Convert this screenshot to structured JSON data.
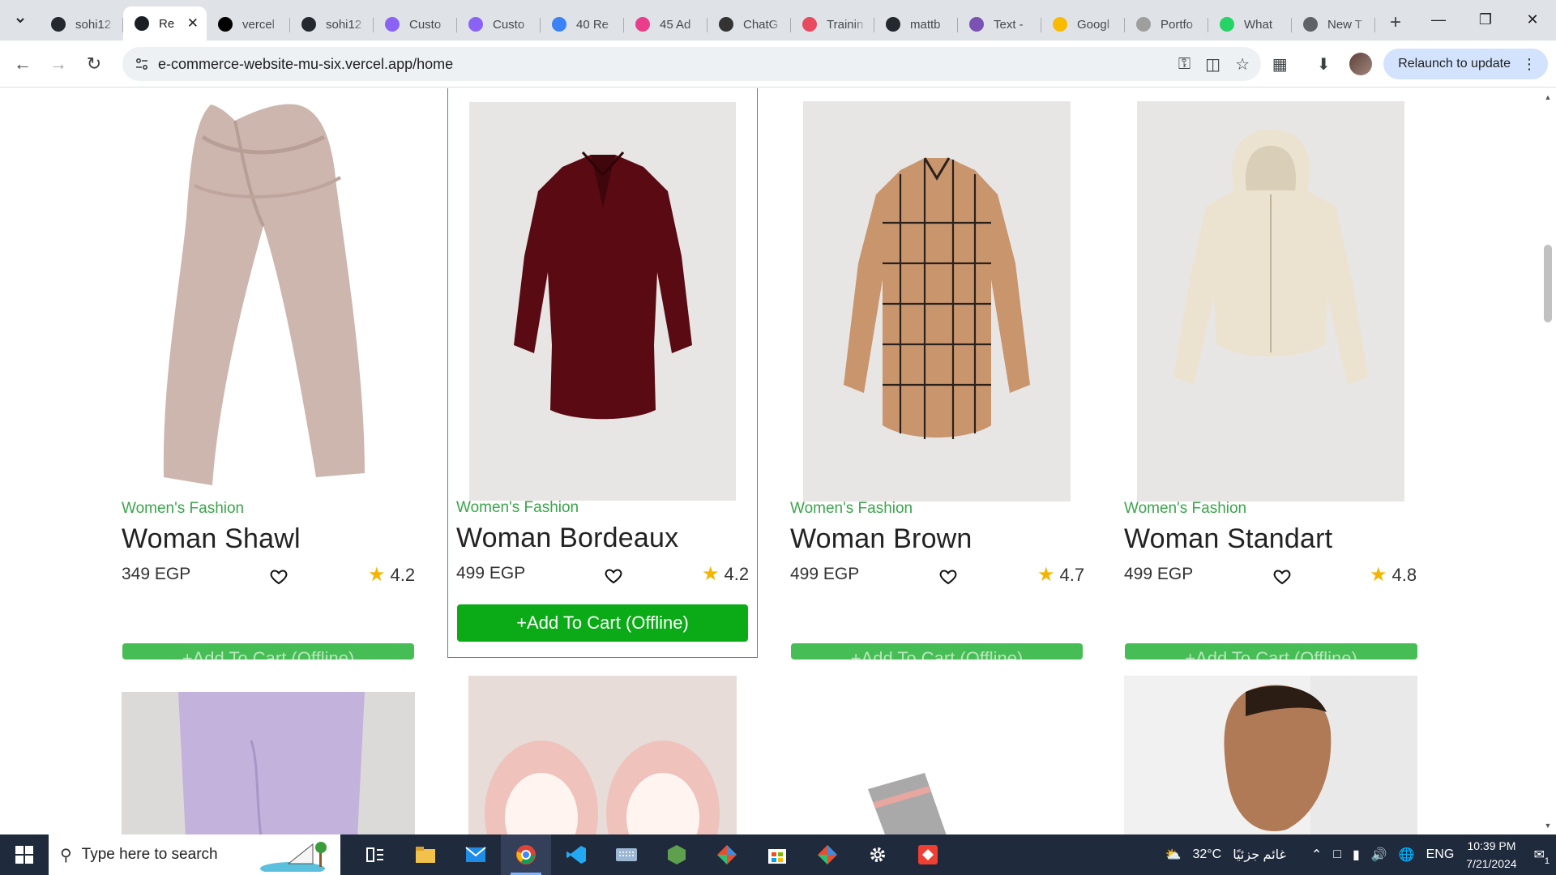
{
  "browser": {
    "tabs": [
      {
        "label": "sohi12",
        "favicon": "github-icon",
        "color": "#24292f",
        "active": false
      },
      {
        "label": "Re",
        "favicon": "react-icon",
        "color": "#1b1f24",
        "active": true
      },
      {
        "label": "vercel",
        "favicon": "vercel-icon",
        "color": "#000000",
        "active": false
      },
      {
        "label": "sohi12",
        "favicon": "github-icon",
        "color": "#24292f",
        "active": false
      },
      {
        "label": "Custo",
        "favicon": "vite-icon",
        "color": "#8a63f5",
        "active": false
      },
      {
        "label": "Custo",
        "favicon": "vite-icon",
        "color": "#8a63f5",
        "active": false
      },
      {
        "label": "40 Re",
        "favicon": "chart-icon",
        "color": "#3b82f6",
        "active": false
      },
      {
        "label": "45 Ad",
        "favicon": "bookmark-icon",
        "color": "#e83e8c",
        "active": false
      },
      {
        "label": "ChatG",
        "favicon": "openai-icon",
        "color": "#333333",
        "active": false
      },
      {
        "label": "Trainin",
        "favicon": "training-icon",
        "color": "#e84a5f",
        "active": false
      },
      {
        "label": "mattb",
        "favicon": "github-icon",
        "color": "#24292f",
        "active": false
      },
      {
        "label": "Text -",
        "favicon": "bootstrap-icon",
        "color": "#7952b3",
        "active": false
      },
      {
        "label": "Googl",
        "favicon": "google-keep-icon",
        "color": "#f9bb00",
        "active": false
      },
      {
        "label": "Portfo",
        "favicon": "portfolio-icon",
        "color": "#9e9e9e",
        "active": false
      },
      {
        "label": "What",
        "favicon": "whatsapp-icon",
        "color": "#25d366",
        "active": false
      },
      {
        "label": "New T",
        "favicon": "chrome-icon",
        "color": "#5f6368",
        "active": false
      }
    ],
    "url": "e-commerce-website-mu-six.vercel.app/home",
    "relaunch_label": "Relaunch to update"
  },
  "products_row1": [
    {
      "category": "Women's Fashion",
      "name": "Woman Shawl",
      "price": "349 EGP",
      "rating": "4.2",
      "button": "+Add To Cart (Offline)",
      "image": "shawl-image"
    },
    {
      "category": "Women's Fashion",
      "name": "Woman Bordeaux",
      "price": "499 EGP",
      "rating": "4.2",
      "button": "+Add To Cart (Offline)",
      "image": "bordeaux-shirt-image"
    },
    {
      "category": "Women's Fashion",
      "name": "Woman Brown",
      "price": "499 EGP",
      "rating": "4.7",
      "button": "+Add To Cart (Offline)",
      "image": "brown-plaid-shirt-image"
    },
    {
      "category": "Women's Fashion",
      "name": "Woman Standart",
      "price": "499 EGP",
      "rating": "4.8",
      "button": "+Add To Cart (Offline)",
      "image": "cream-hoodie-image"
    }
  ],
  "colors": {
    "accent_green": "#0aab16",
    "category_green": "#3aa54a",
    "star": "#f5b400"
  },
  "taskbar": {
    "search_placeholder": "Type here to search",
    "weather": "32°C",
    "weather_text": "غائم جزئيًا",
    "language": "ENG",
    "time": "10:39 PM",
    "date": "7/21/2024",
    "notification_count": "1"
  }
}
